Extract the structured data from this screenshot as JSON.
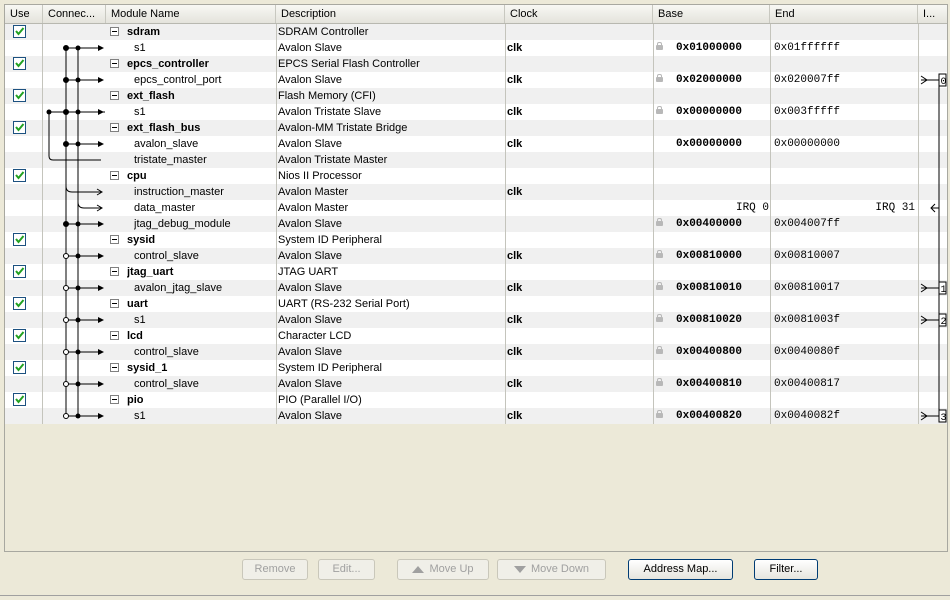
{
  "columns": {
    "use": "Use",
    "connections": "Connec...",
    "module_name": "Module Name",
    "description": "Description",
    "clock": "Clock",
    "base": "Base",
    "end": "End",
    "irq": "I..."
  },
  "rows": [
    {
      "type": "module",
      "checked": true,
      "name": "sdram",
      "description": "SDRAM Controller"
    },
    {
      "type": "port",
      "name": "s1",
      "description": "Avalon Slave",
      "clock": "clk",
      "locked": true,
      "base": "0x01000000",
      "end": "0x01ffffff"
    },
    {
      "type": "module",
      "checked": true,
      "name": "epcs_controller",
      "description": "EPCS Serial Flash Controller"
    },
    {
      "type": "port",
      "name": "epcs_control_port",
      "description": "Avalon Slave",
      "clock": "clk",
      "locked": true,
      "base": "0x02000000",
      "end": "0x020007ff",
      "irq": "0"
    },
    {
      "type": "module",
      "checked": true,
      "name": "ext_flash",
      "description": "Flash Memory (CFI)"
    },
    {
      "type": "port",
      "name": "s1",
      "description": "Avalon Tristate Slave",
      "clock": "clk",
      "locked": true,
      "base": "0x00000000",
      "end": "0x003fffff"
    },
    {
      "type": "module",
      "checked": true,
      "name": "ext_flash_bus",
      "description": "Avalon-MM Tristate Bridge"
    },
    {
      "type": "port",
      "name": "avalon_slave",
      "description": "Avalon Slave",
      "clock": "clk",
      "base": "0x00000000",
      "end": "0x00000000"
    },
    {
      "type": "port",
      "name": "tristate_master",
      "description": "Avalon Tristate Master"
    },
    {
      "type": "module",
      "checked": true,
      "name": "cpu",
      "description": "Nios II Processor"
    },
    {
      "type": "port",
      "name": "instruction_master",
      "description": "Avalon Master",
      "clock": "clk"
    },
    {
      "type": "port",
      "name": "data_master",
      "description": "Avalon Master",
      "base_text": "IRQ 0",
      "end_text": "IRQ 31"
    },
    {
      "type": "port",
      "name": "jtag_debug_module",
      "description": "Avalon Slave",
      "locked": true,
      "base": "0x00400000",
      "end": "0x004007ff"
    },
    {
      "type": "module",
      "checked": true,
      "name": "sysid",
      "description": "System ID Peripheral"
    },
    {
      "type": "port",
      "name": "control_slave",
      "description": "Avalon Slave",
      "clock": "clk",
      "locked": true,
      "base": "0x00810000",
      "end": "0x00810007"
    },
    {
      "type": "module",
      "checked": true,
      "name": "jtag_uart",
      "description": "JTAG UART"
    },
    {
      "type": "port",
      "name": "avalon_jtag_slave",
      "description": "Avalon Slave",
      "clock": "clk",
      "locked": true,
      "base": "0x00810010",
      "end": "0x00810017",
      "irq": "1"
    },
    {
      "type": "module",
      "checked": true,
      "name": "uart",
      "description": "UART (RS-232 Serial Port)"
    },
    {
      "type": "port",
      "name": "s1",
      "description": "Avalon Slave",
      "clock": "clk",
      "locked": true,
      "base": "0x00810020",
      "end": "0x0081003f",
      "irq": "2"
    },
    {
      "type": "module",
      "checked": true,
      "name": "lcd",
      "description": "Character LCD"
    },
    {
      "type": "port",
      "name": "control_slave",
      "description": "Avalon Slave",
      "clock": "clk",
      "locked": true,
      "base": "0x00400800",
      "end": "0x0040080f"
    },
    {
      "type": "module",
      "checked": true,
      "name": "sysid_1",
      "description": "System ID Peripheral"
    },
    {
      "type": "port",
      "name": "control_slave",
      "description": "Avalon Slave",
      "clock": "clk",
      "locked": true,
      "base": "0x00400810",
      "end": "0x00400817"
    },
    {
      "type": "module",
      "checked": true,
      "name": "pio",
      "description": "PIO (Parallel I/O)"
    },
    {
      "type": "port",
      "name": "s1",
      "description": "Avalon Slave",
      "clock": "clk",
      "locked": true,
      "base": "0x00400820",
      "end": "0x0040082f",
      "irq": "3"
    }
  ],
  "buttons": {
    "remove": "Remove",
    "edit": "Edit...",
    "move_up": "Move Up",
    "move_down": "Move Down",
    "address_map": "Address Map...",
    "filter": "Filter..."
  },
  "colors": {
    "checkbox_check": "#21a121",
    "window_bg": "#ece9d8",
    "row_alt": "#f0f0f0"
  }
}
